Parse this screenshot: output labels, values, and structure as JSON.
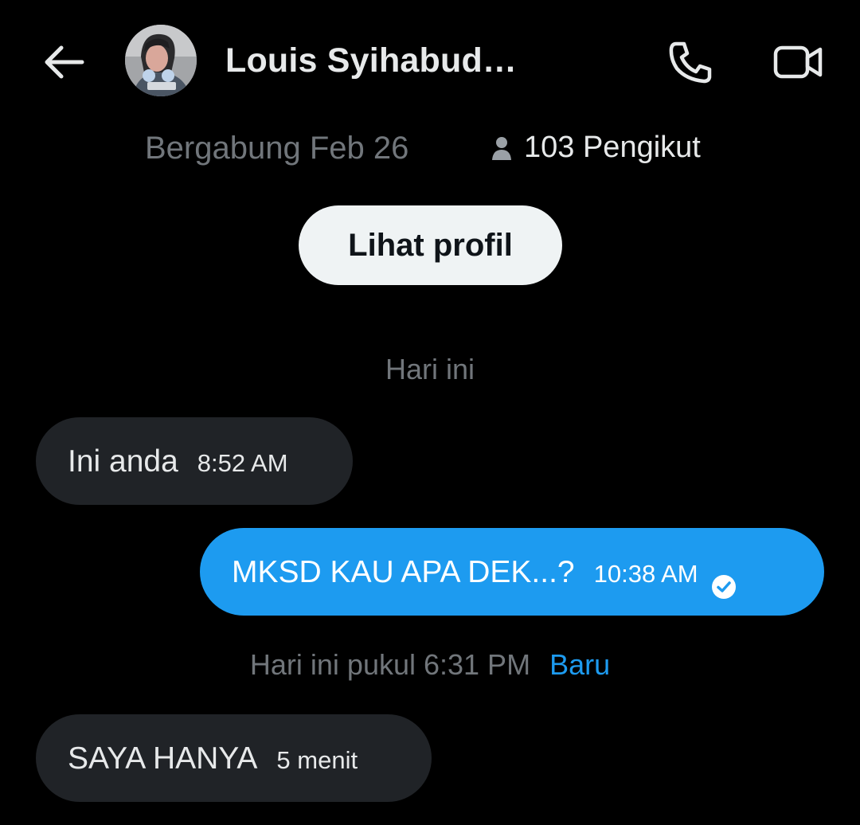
{
  "header": {
    "title": "Louis Syihabud…",
    "back_icon": "arrow-left-icon",
    "call_icon": "phone-icon",
    "video_icon": "video-camera-icon"
  },
  "profile": {
    "joined": "Bergabung Feb 26",
    "followers_icon": "person-icon",
    "followers": "103 Pengikut",
    "view_profile_label": "Lihat profil"
  },
  "conversation": {
    "separator_today": "Hari ini",
    "messages": [
      {
        "text": "Ini anda",
        "time": "8:52 AM",
        "direction": "incoming"
      },
      {
        "text": "MKSD KAU APA DEK...?",
        "time": "10:38 AM",
        "direction": "outgoing",
        "status_icon": "check-circle-icon"
      }
    ],
    "separator_later": {
      "text": "Hari ini pukul 6:31 PM",
      "badge": "Baru"
    },
    "messages_later": [
      {
        "text": "SAYA HANYA",
        "time": "5 menit",
        "direction": "incoming"
      }
    ]
  },
  "colors": {
    "background": "#000000",
    "accent": "#1d9bf0",
    "incoming_bubble": "#202327",
    "muted_text": "#71767b"
  }
}
